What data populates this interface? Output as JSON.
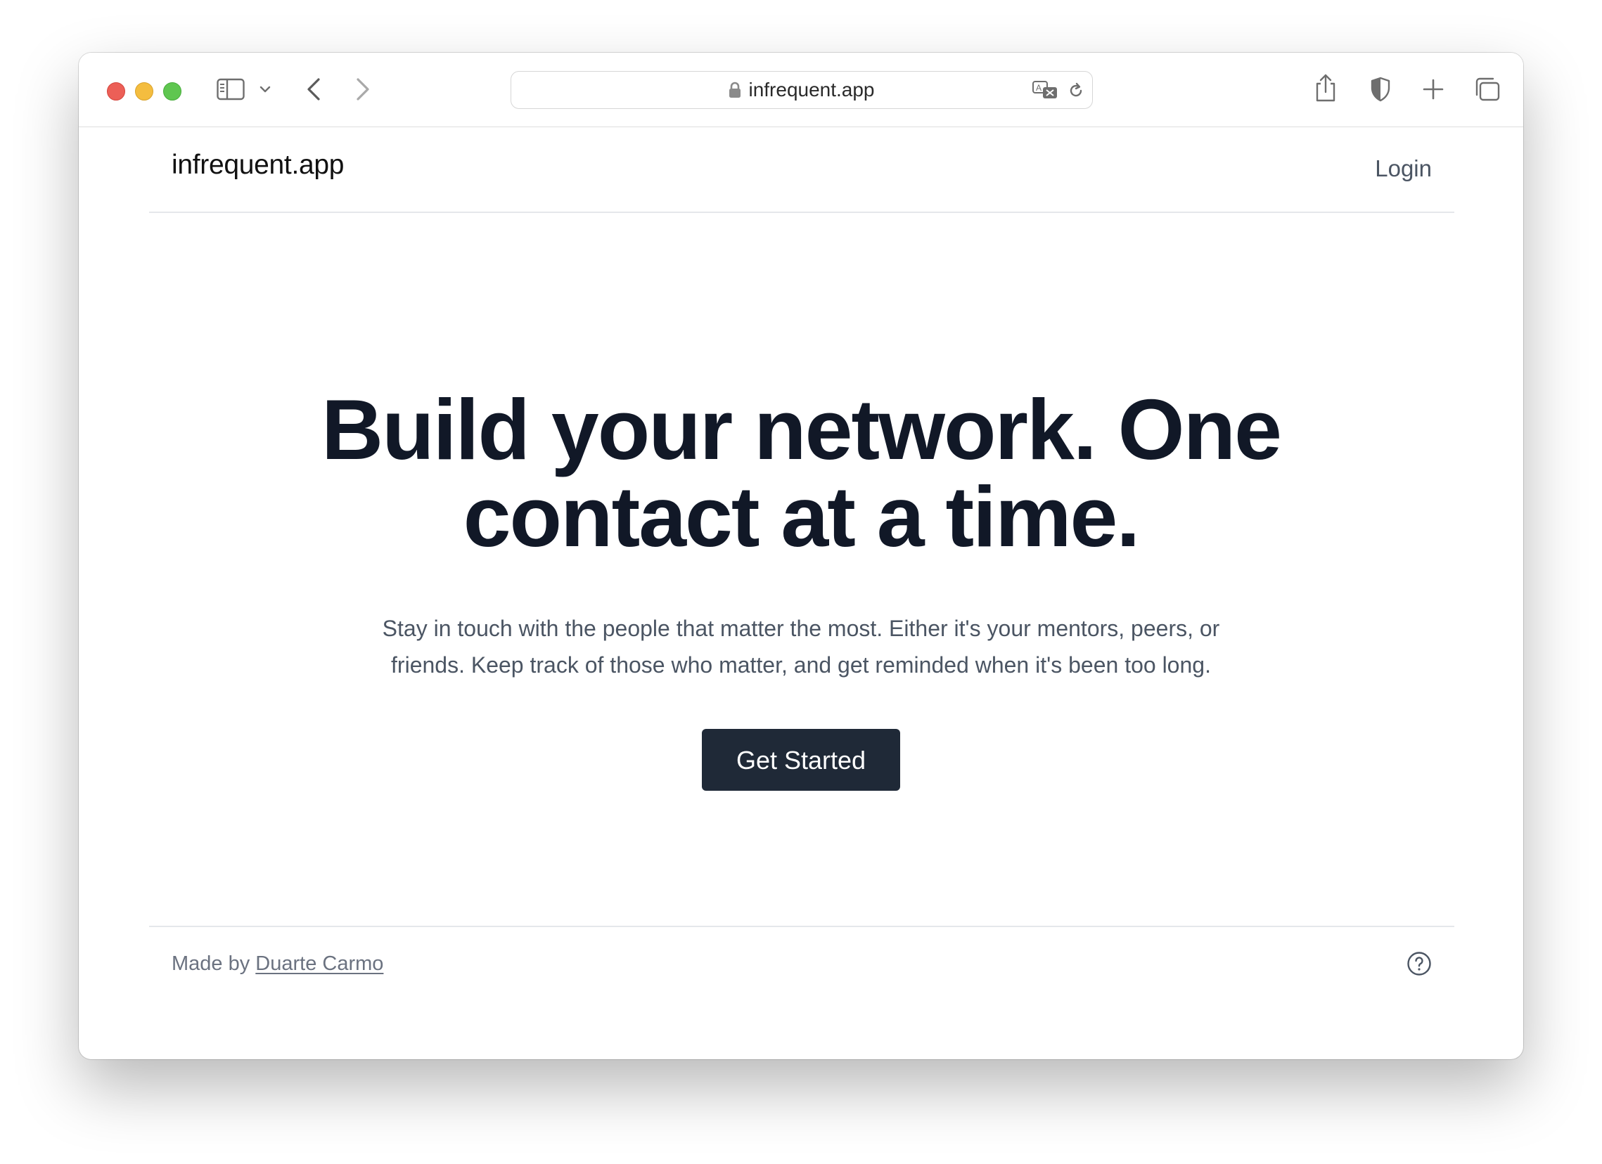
{
  "browser": {
    "url": "infrequent.app",
    "icons": {
      "sidebar": "sidebar-icon",
      "sidebar_menu": "chevron-down-icon",
      "back": "back-arrow-icon",
      "forward": "forward-arrow-icon",
      "secure": "lock-icon",
      "translate": "translate-icon",
      "reload": "reload-icon",
      "share": "share-icon",
      "privacy": "shield-icon",
      "new_tab": "plus-icon",
      "tab_overview": "tabs-icon"
    }
  },
  "nav": {
    "brand": "infrequent.app",
    "login": "Login"
  },
  "hero": {
    "title_line_1": "Build your network. One",
    "title_line_2": "contact at a time.",
    "subtitle_line_1": "Stay in touch with the people that matter the most. Either it's your mentors, peers, or",
    "subtitle_line_2": "friends. Keep track of those who matter, and get reminded when it's been too long.",
    "cta_label": "Get Started"
  },
  "footer": {
    "made_by_prefix": "Made by ",
    "author": "Duarte Carmo",
    "help_icon": "help-circle-icon"
  },
  "colors": {
    "cta_background": "#1f2937",
    "heading": "#111827",
    "body_text": "#4b5563",
    "divider": "#e5e7eb"
  }
}
